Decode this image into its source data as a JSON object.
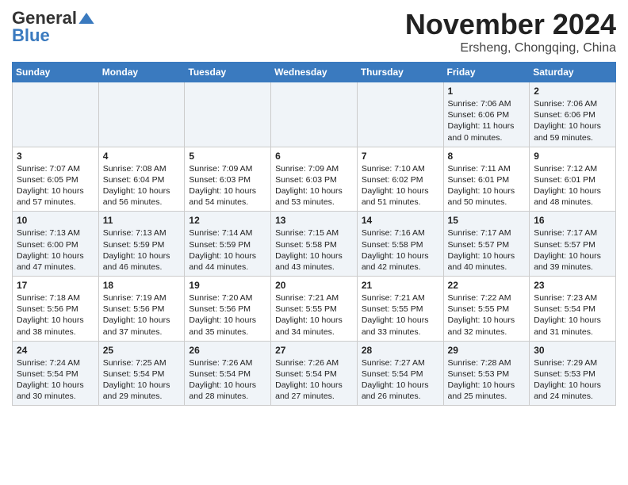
{
  "header": {
    "logo_general": "General",
    "logo_blue": "Blue",
    "month_title": "November 2024",
    "location": "Ersheng, Chongqing, China"
  },
  "weekdays": [
    "Sunday",
    "Monday",
    "Tuesday",
    "Wednesday",
    "Thursday",
    "Friday",
    "Saturday"
  ],
  "weeks": [
    [
      {
        "day": "",
        "text": ""
      },
      {
        "day": "",
        "text": ""
      },
      {
        "day": "",
        "text": ""
      },
      {
        "day": "",
        "text": ""
      },
      {
        "day": "",
        "text": ""
      },
      {
        "day": "1",
        "text": "Sunrise: 7:06 AM\nSunset: 6:06 PM\nDaylight: 11 hours\nand 0 minutes."
      },
      {
        "day": "2",
        "text": "Sunrise: 7:06 AM\nSunset: 6:06 PM\nDaylight: 10 hours\nand 59 minutes."
      }
    ],
    [
      {
        "day": "3",
        "text": "Sunrise: 7:07 AM\nSunset: 6:05 PM\nDaylight: 10 hours\nand 57 minutes."
      },
      {
        "day": "4",
        "text": "Sunrise: 7:08 AM\nSunset: 6:04 PM\nDaylight: 10 hours\nand 56 minutes."
      },
      {
        "day": "5",
        "text": "Sunrise: 7:09 AM\nSunset: 6:03 PM\nDaylight: 10 hours\nand 54 minutes."
      },
      {
        "day": "6",
        "text": "Sunrise: 7:09 AM\nSunset: 6:03 PM\nDaylight: 10 hours\nand 53 minutes."
      },
      {
        "day": "7",
        "text": "Sunrise: 7:10 AM\nSunset: 6:02 PM\nDaylight: 10 hours\nand 51 minutes."
      },
      {
        "day": "8",
        "text": "Sunrise: 7:11 AM\nSunset: 6:01 PM\nDaylight: 10 hours\nand 50 minutes."
      },
      {
        "day": "9",
        "text": "Sunrise: 7:12 AM\nSunset: 6:01 PM\nDaylight: 10 hours\nand 48 minutes."
      }
    ],
    [
      {
        "day": "10",
        "text": "Sunrise: 7:13 AM\nSunset: 6:00 PM\nDaylight: 10 hours\nand 47 minutes."
      },
      {
        "day": "11",
        "text": "Sunrise: 7:13 AM\nSunset: 5:59 PM\nDaylight: 10 hours\nand 46 minutes."
      },
      {
        "day": "12",
        "text": "Sunrise: 7:14 AM\nSunset: 5:59 PM\nDaylight: 10 hours\nand 44 minutes."
      },
      {
        "day": "13",
        "text": "Sunrise: 7:15 AM\nSunset: 5:58 PM\nDaylight: 10 hours\nand 43 minutes."
      },
      {
        "day": "14",
        "text": "Sunrise: 7:16 AM\nSunset: 5:58 PM\nDaylight: 10 hours\nand 42 minutes."
      },
      {
        "day": "15",
        "text": "Sunrise: 7:17 AM\nSunset: 5:57 PM\nDaylight: 10 hours\nand 40 minutes."
      },
      {
        "day": "16",
        "text": "Sunrise: 7:17 AM\nSunset: 5:57 PM\nDaylight: 10 hours\nand 39 minutes."
      }
    ],
    [
      {
        "day": "17",
        "text": "Sunrise: 7:18 AM\nSunset: 5:56 PM\nDaylight: 10 hours\nand 38 minutes."
      },
      {
        "day": "18",
        "text": "Sunrise: 7:19 AM\nSunset: 5:56 PM\nDaylight: 10 hours\nand 37 minutes."
      },
      {
        "day": "19",
        "text": "Sunrise: 7:20 AM\nSunset: 5:56 PM\nDaylight: 10 hours\nand 35 minutes."
      },
      {
        "day": "20",
        "text": "Sunrise: 7:21 AM\nSunset: 5:55 PM\nDaylight: 10 hours\nand 34 minutes."
      },
      {
        "day": "21",
        "text": "Sunrise: 7:21 AM\nSunset: 5:55 PM\nDaylight: 10 hours\nand 33 minutes."
      },
      {
        "day": "22",
        "text": "Sunrise: 7:22 AM\nSunset: 5:55 PM\nDaylight: 10 hours\nand 32 minutes."
      },
      {
        "day": "23",
        "text": "Sunrise: 7:23 AM\nSunset: 5:54 PM\nDaylight: 10 hours\nand 31 minutes."
      }
    ],
    [
      {
        "day": "24",
        "text": "Sunrise: 7:24 AM\nSunset: 5:54 PM\nDaylight: 10 hours\nand 30 minutes."
      },
      {
        "day": "25",
        "text": "Sunrise: 7:25 AM\nSunset: 5:54 PM\nDaylight: 10 hours\nand 29 minutes."
      },
      {
        "day": "26",
        "text": "Sunrise: 7:26 AM\nSunset: 5:54 PM\nDaylight: 10 hours\nand 28 minutes."
      },
      {
        "day": "27",
        "text": "Sunrise: 7:26 AM\nSunset: 5:54 PM\nDaylight: 10 hours\nand 27 minutes."
      },
      {
        "day": "28",
        "text": "Sunrise: 7:27 AM\nSunset: 5:54 PM\nDaylight: 10 hours\nand 26 minutes."
      },
      {
        "day": "29",
        "text": "Sunrise: 7:28 AM\nSunset: 5:53 PM\nDaylight: 10 hours\nand 25 minutes."
      },
      {
        "day": "30",
        "text": "Sunrise: 7:29 AM\nSunset: 5:53 PM\nDaylight: 10 hours\nand 24 minutes."
      }
    ]
  ]
}
